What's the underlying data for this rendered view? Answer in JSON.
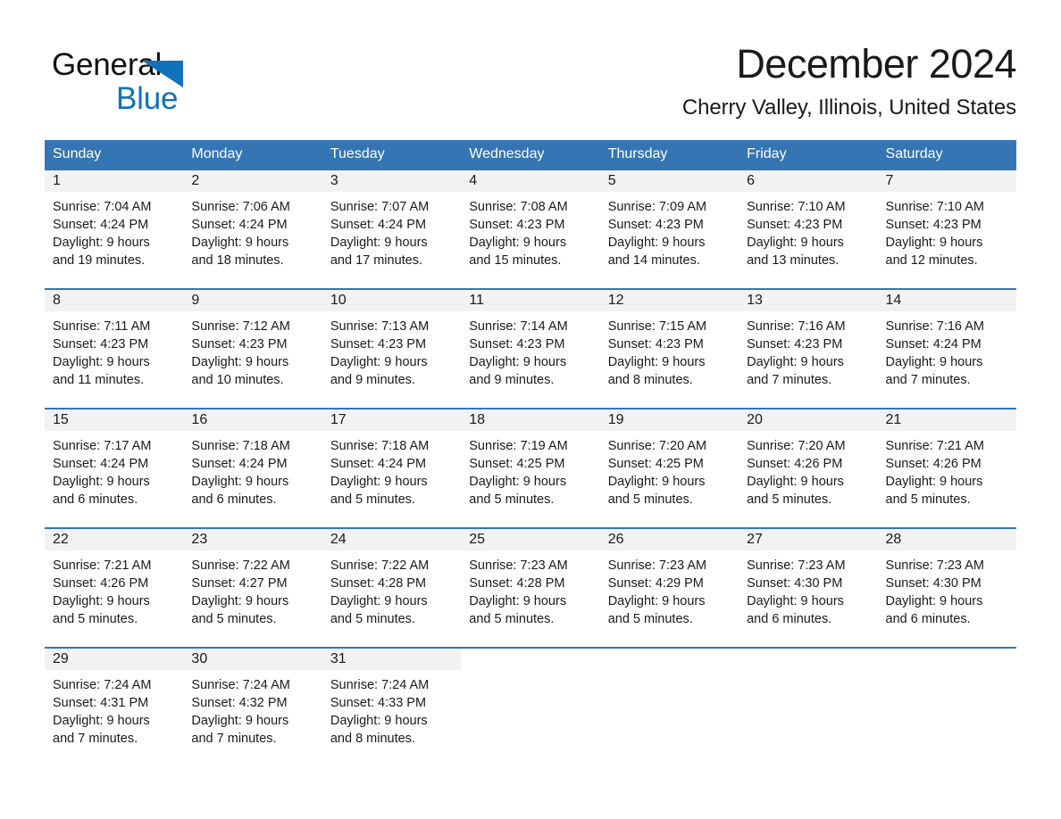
{
  "brand": {
    "name_part1": "General",
    "name_part2": "Blue",
    "triangle_color": "#1072bb",
    "text_color": "#111111",
    "blue_color": "#1072bb"
  },
  "header": {
    "title": "December 2024",
    "subtitle": "Cherry Valley, Illinois, United States"
  },
  "theme": {
    "header_blue": "#3575b4",
    "day_band_gray": "#f2f2f2",
    "text_dark": "#1a1a1a"
  },
  "weekday_headers": [
    "Sunday",
    "Monday",
    "Tuesday",
    "Wednesday",
    "Thursday",
    "Friday",
    "Saturday"
  ],
  "weeks": [
    [
      {
        "day": "1",
        "sunrise": "Sunrise: 7:04 AM",
        "sunset": "Sunset: 4:24 PM",
        "daylight1": "Daylight: 9 hours",
        "daylight2": "and 19 minutes."
      },
      {
        "day": "2",
        "sunrise": "Sunrise: 7:06 AM",
        "sunset": "Sunset: 4:24 PM",
        "daylight1": "Daylight: 9 hours",
        "daylight2": "and 18 minutes."
      },
      {
        "day": "3",
        "sunrise": "Sunrise: 7:07 AM",
        "sunset": "Sunset: 4:24 PM",
        "daylight1": "Daylight: 9 hours",
        "daylight2": "and 17 minutes."
      },
      {
        "day": "4",
        "sunrise": "Sunrise: 7:08 AM",
        "sunset": "Sunset: 4:23 PM",
        "daylight1": "Daylight: 9 hours",
        "daylight2": "and 15 minutes."
      },
      {
        "day": "5",
        "sunrise": "Sunrise: 7:09 AM",
        "sunset": "Sunset: 4:23 PM",
        "daylight1": "Daylight: 9 hours",
        "daylight2": "and 14 minutes."
      },
      {
        "day": "6",
        "sunrise": "Sunrise: 7:10 AM",
        "sunset": "Sunset: 4:23 PM",
        "daylight1": "Daylight: 9 hours",
        "daylight2": "and 13 minutes."
      },
      {
        "day": "7",
        "sunrise": "Sunrise: 7:10 AM",
        "sunset": "Sunset: 4:23 PM",
        "daylight1": "Daylight: 9 hours",
        "daylight2": "and 12 minutes."
      }
    ],
    [
      {
        "day": "8",
        "sunrise": "Sunrise: 7:11 AM",
        "sunset": "Sunset: 4:23 PM",
        "daylight1": "Daylight: 9 hours",
        "daylight2": "and 11 minutes."
      },
      {
        "day": "9",
        "sunrise": "Sunrise: 7:12 AM",
        "sunset": "Sunset: 4:23 PM",
        "daylight1": "Daylight: 9 hours",
        "daylight2": "and 10 minutes."
      },
      {
        "day": "10",
        "sunrise": "Sunrise: 7:13 AM",
        "sunset": "Sunset: 4:23 PM",
        "daylight1": "Daylight: 9 hours",
        "daylight2": "and 9 minutes."
      },
      {
        "day": "11",
        "sunrise": "Sunrise: 7:14 AM",
        "sunset": "Sunset: 4:23 PM",
        "daylight1": "Daylight: 9 hours",
        "daylight2": "and 9 minutes."
      },
      {
        "day": "12",
        "sunrise": "Sunrise: 7:15 AM",
        "sunset": "Sunset: 4:23 PM",
        "daylight1": "Daylight: 9 hours",
        "daylight2": "and 8 minutes."
      },
      {
        "day": "13",
        "sunrise": "Sunrise: 7:16 AM",
        "sunset": "Sunset: 4:23 PM",
        "daylight1": "Daylight: 9 hours",
        "daylight2": "and 7 minutes."
      },
      {
        "day": "14",
        "sunrise": "Sunrise: 7:16 AM",
        "sunset": "Sunset: 4:24 PM",
        "daylight1": "Daylight: 9 hours",
        "daylight2": "and 7 minutes."
      }
    ],
    [
      {
        "day": "15",
        "sunrise": "Sunrise: 7:17 AM",
        "sunset": "Sunset: 4:24 PM",
        "daylight1": "Daylight: 9 hours",
        "daylight2": "and 6 minutes."
      },
      {
        "day": "16",
        "sunrise": "Sunrise: 7:18 AM",
        "sunset": "Sunset: 4:24 PM",
        "daylight1": "Daylight: 9 hours",
        "daylight2": "and 6 minutes."
      },
      {
        "day": "17",
        "sunrise": "Sunrise: 7:18 AM",
        "sunset": "Sunset: 4:24 PM",
        "daylight1": "Daylight: 9 hours",
        "daylight2": "and 5 minutes."
      },
      {
        "day": "18",
        "sunrise": "Sunrise: 7:19 AM",
        "sunset": "Sunset: 4:25 PM",
        "daylight1": "Daylight: 9 hours",
        "daylight2": "and 5 minutes."
      },
      {
        "day": "19",
        "sunrise": "Sunrise: 7:20 AM",
        "sunset": "Sunset: 4:25 PM",
        "daylight1": "Daylight: 9 hours",
        "daylight2": "and 5 minutes."
      },
      {
        "day": "20",
        "sunrise": "Sunrise: 7:20 AM",
        "sunset": "Sunset: 4:26 PM",
        "daylight1": "Daylight: 9 hours",
        "daylight2": "and 5 minutes."
      },
      {
        "day": "21",
        "sunrise": "Sunrise: 7:21 AM",
        "sunset": "Sunset: 4:26 PM",
        "daylight1": "Daylight: 9 hours",
        "daylight2": "and 5 minutes."
      }
    ],
    [
      {
        "day": "22",
        "sunrise": "Sunrise: 7:21 AM",
        "sunset": "Sunset: 4:26 PM",
        "daylight1": "Daylight: 9 hours",
        "daylight2": "and 5 minutes."
      },
      {
        "day": "23",
        "sunrise": "Sunrise: 7:22 AM",
        "sunset": "Sunset: 4:27 PM",
        "daylight1": "Daylight: 9 hours",
        "daylight2": "and 5 minutes."
      },
      {
        "day": "24",
        "sunrise": "Sunrise: 7:22 AM",
        "sunset": "Sunset: 4:28 PM",
        "daylight1": "Daylight: 9 hours",
        "daylight2": "and 5 minutes."
      },
      {
        "day": "25",
        "sunrise": "Sunrise: 7:23 AM",
        "sunset": "Sunset: 4:28 PM",
        "daylight1": "Daylight: 9 hours",
        "daylight2": "and 5 minutes."
      },
      {
        "day": "26",
        "sunrise": "Sunrise: 7:23 AM",
        "sunset": "Sunset: 4:29 PM",
        "daylight1": "Daylight: 9 hours",
        "daylight2": "and 5 minutes."
      },
      {
        "day": "27",
        "sunrise": "Sunrise: 7:23 AM",
        "sunset": "Sunset: 4:30 PM",
        "daylight1": "Daylight: 9 hours",
        "daylight2": "and 6 minutes."
      },
      {
        "day": "28",
        "sunrise": "Sunrise: 7:23 AM",
        "sunset": "Sunset: 4:30 PM",
        "daylight1": "Daylight: 9 hours",
        "daylight2": "and 6 minutes."
      }
    ],
    [
      {
        "day": "29",
        "sunrise": "Sunrise: 7:24 AM",
        "sunset": "Sunset: 4:31 PM",
        "daylight1": "Daylight: 9 hours",
        "daylight2": "and 7 minutes."
      },
      {
        "day": "30",
        "sunrise": "Sunrise: 7:24 AM",
        "sunset": "Sunset: 4:32 PM",
        "daylight1": "Daylight: 9 hours",
        "daylight2": "and 7 minutes."
      },
      {
        "day": "31",
        "sunrise": "Sunrise: 7:24 AM",
        "sunset": "Sunset: 4:33 PM",
        "daylight1": "Daylight: 9 hours",
        "daylight2": "and 8 minutes."
      },
      {
        "day": "",
        "sunrise": "",
        "sunset": "",
        "daylight1": "",
        "daylight2": ""
      },
      {
        "day": "",
        "sunrise": "",
        "sunset": "",
        "daylight1": "",
        "daylight2": ""
      },
      {
        "day": "",
        "sunrise": "",
        "sunset": "",
        "daylight1": "",
        "daylight2": ""
      },
      {
        "day": "",
        "sunrise": "",
        "sunset": "",
        "daylight1": "",
        "daylight2": ""
      }
    ]
  ]
}
